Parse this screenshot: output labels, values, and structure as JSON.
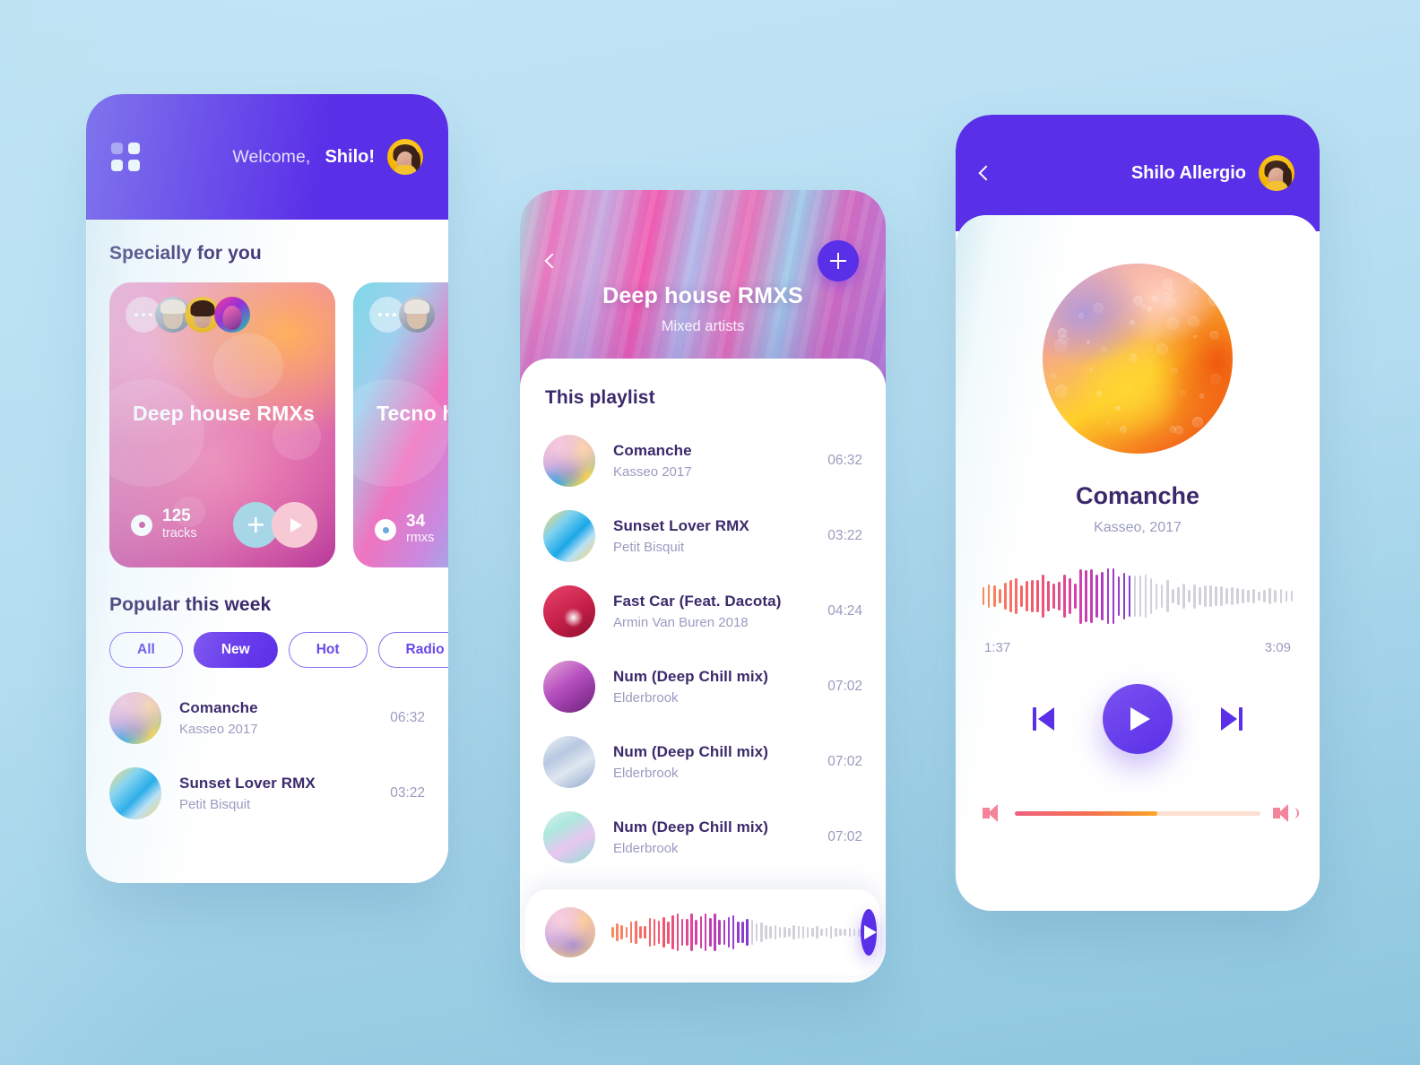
{
  "theme": {
    "brand_purple": "#5a2fe8",
    "bg_blue": "#bce3f5",
    "text_dark": "#3b2a6b",
    "text_muted": "#9a9cc0"
  },
  "home": {
    "grid_icon": "grid-icon",
    "welcome_label": "Welcome,",
    "user_name": "Shilo!",
    "section_specially": "Specially for you",
    "cards": [
      {
        "title": "Deep house RMXs",
        "count": "125",
        "unit": "tracks",
        "add_label": "+",
        "play_label": "play"
      },
      {
        "title": "Tecno house RMXs",
        "count": "34",
        "unit": "rmxs"
      }
    ],
    "section_popular": "Popular this week",
    "chips": [
      {
        "label": "All",
        "active": false
      },
      {
        "label": "New",
        "active": true
      },
      {
        "label": "Hot",
        "active": false
      },
      {
        "label": "Radio ch",
        "active": false
      }
    ],
    "tracks": [
      {
        "title": "Comanche",
        "artist": "Kasseo 2017",
        "time": "06:32"
      },
      {
        "title": "Sunset Lover RMX",
        "artist": "Petit Bisquit",
        "time": "03:22"
      }
    ]
  },
  "playlist": {
    "hero_title": "Deep house RMXS",
    "hero_subtitle": "Mixed artists",
    "add_label": "+",
    "section_title": "This playlist",
    "tracks": [
      {
        "title": "Comanche",
        "artist": "Kasseo 2017",
        "time": "06:32"
      },
      {
        "title": "Sunset Lover RMX",
        "artist": "Petit Bisquit",
        "time": "03:22"
      },
      {
        "title": "Fast Car (Feat. Dacota)",
        "artist": "Armin Van Buren 2018",
        "time": "04:24"
      },
      {
        "title": "Num (Deep Chill mix)",
        "artist": "Elderbrook",
        "time": "07:02"
      },
      {
        "title": "Num (Deep Chill mix)",
        "artist": "Elderbrook",
        "time": "07:02"
      },
      {
        "title": "Num (Deep Chill mix)",
        "artist": "Elderbrook",
        "time": "07:02"
      }
    ],
    "mini_player": {
      "play_label": "play",
      "next_label": "next"
    }
  },
  "player": {
    "header_title": "Shilo Allergio",
    "back_label": "back",
    "track_title": "Comanche",
    "track_artist": "Kasseo, 2017",
    "elapsed": "1:37",
    "duration": "3:09",
    "controls": {
      "prev": "previous",
      "play": "play",
      "next": "next"
    },
    "volume_percent": 58
  }
}
